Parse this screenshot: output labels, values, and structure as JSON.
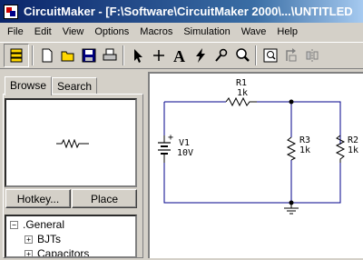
{
  "window": {
    "title": "CircuitMaker - [F:\\Software\\CircuitMaker 2000\\...\\UNTITLED"
  },
  "menu": [
    {
      "label": "File"
    },
    {
      "label": "Edit"
    },
    {
      "label": "View"
    },
    {
      "label": "Options"
    },
    {
      "label": "Macros"
    },
    {
      "label": "Simulation"
    },
    {
      "label": "Wave"
    },
    {
      "label": "Help"
    }
  ],
  "toolbar": {
    "icons": [
      "toggle-panel-icon",
      "new-file-icon",
      "open-folder-icon",
      "save-icon",
      "print-icon",
      "arrow-pointer-icon",
      "wire-cross-icon",
      "text-tool-icon",
      "probe-lightning-icon",
      "probe-pen-icon",
      "zoom-icon",
      "zoom-fit-icon",
      "rotate-icon",
      "mirror-icon"
    ]
  },
  "left_panel": {
    "tabs": [
      {
        "label": "Browse"
      },
      {
        "label": "Search"
      }
    ],
    "buttons": {
      "hotkey": "Hotkey...",
      "place": "Place"
    },
    "tree": [
      {
        "label": ".General",
        "expander": "−"
      },
      {
        "label": "BJTs",
        "expander": "+"
      },
      {
        "label": "Capacitors",
        "expander": "+"
      }
    ]
  },
  "schematic": {
    "r1": {
      "name": "R1",
      "value": "1k"
    },
    "r2": {
      "name": "R2",
      "value": "1k"
    },
    "r3": {
      "name": "R3",
      "value": "1k"
    },
    "v1": {
      "name": "V1",
      "value": "10V",
      "polarity": "+"
    },
    "wire_color": "#00008b",
    "component_color": "#000000"
  }
}
